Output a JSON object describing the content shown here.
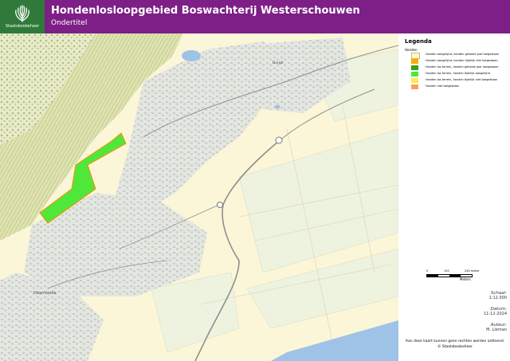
{
  "header": {
    "title": "Hondenlosloopgebied Boswachterij Westerschouwen",
    "subtitle": "Ondertitel",
    "brand": "Staatsbosbeheer",
    "background_color": "#7d1f86",
    "logo_color": "#2f7a3a",
    "logo_icon": "tree-icon"
  },
  "map": {
    "place_labels": [
      "Haamstede",
      "Burgh"
    ],
    "highlighted_area_category": "Honden los terrein, honden tijdelijk aangelijnd",
    "colors": {
      "dunes": "#e9e9b9",
      "forest_hatch": "#bfc98f",
      "farmland": "#fbf6d8",
      "meadow": "#eef3df",
      "built_up": "#d9dcd8",
      "water": "#9fc3e6",
      "roads": "#8a8a8a",
      "highlight_fill": "#4fe83a",
      "highlight_stroke": "#ff8800"
    }
  },
  "legend": {
    "title": "Legenda",
    "group": "Honden",
    "items": [
      {
        "label": "Honden aangelijnd, honden geheele jaar toegestaan",
        "color": "#fff8d0"
      },
      {
        "label": "Honden aangelijnd, honden tijdelijk niet toegestaan",
        "color": "#ffaa00"
      },
      {
        "label": "Honden los terrein, honden geheele jaar toegestaan",
        "color": "#3aa312"
      },
      {
        "label": "Honden los terrein, honden tijdelijk aangelijnd",
        "color": "#4fe83a"
      },
      {
        "label": "Honden los terrein, honden tijdelijk niet toegestaan",
        "color": "#ffe94d"
      },
      {
        "label": "Honden niet toegestaan",
        "color": "#f7a15b"
      }
    ]
  },
  "scalebar": {
    "ticks": [
      "0",
      "120",
      "240 meter"
    ],
    "unit": "Meters"
  },
  "info": {
    "schaal_label": "Schaal:",
    "schaal_value": "1:12.000",
    "datum_label": "Datum:",
    "datum_value": "11-12-2024",
    "auteur_label": "Auteur:",
    "auteur_value": "M. Lieman"
  },
  "disclaimer": {
    "line1": "Aan deze kaart kunnen geen rechten worden ontleend.",
    "line2": "© Staatsbosbeheer"
  }
}
